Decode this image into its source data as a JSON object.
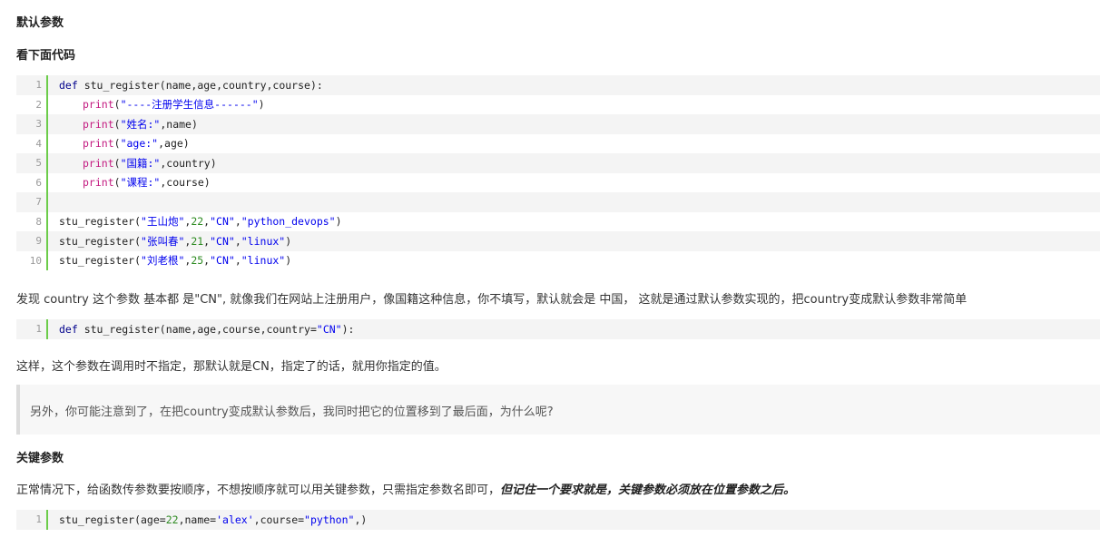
{
  "headings": {
    "default_params": "默认参数",
    "see_code": "看下面代码",
    "keyword_params": "关键参数"
  },
  "code_block_1": {
    "line_numbers": [
      "1",
      "2",
      "3",
      "4",
      "5",
      "6",
      "7",
      "8",
      "9",
      "10"
    ],
    "lines": {
      "l1": {
        "kw": "def",
        "rest": " stu_register(name,age,country,course):"
      },
      "l2": {
        "fn": "print",
        "a": "(",
        "s": "\"----注册学生信息------\"",
        "b": ")"
      },
      "l3": {
        "fn": "print",
        "a": "(",
        "s": "\"姓名:\"",
        "b": ",name)"
      },
      "l4": {
        "fn": "print",
        "a": "(",
        "s": "\"age:\"",
        "b": ",age)"
      },
      "l5": {
        "fn": "print",
        "a": "(",
        "s": "\"国籍:\"",
        "b": ",country)"
      },
      "l6": {
        "fn": "print",
        "a": "(",
        "s": "\"课程:\"",
        "b": ",course)"
      },
      "l8": {
        "a": "stu_register(",
        "s1": "\"王山炮\"",
        "c1": ",",
        "n": "22",
        "c2": ",",
        "s2": "\"CN\"",
        "c3": ",",
        "s3": "\"python_devops\"",
        "b": ")"
      },
      "l9": {
        "a": "stu_register(",
        "s1": "\"张叫春\"",
        "c1": ",",
        "n": "21",
        "c2": ",",
        "s2": "\"CN\"",
        "c3": ",",
        "s3": "\"linux\"",
        "b": ")"
      },
      "l10": {
        "a": "stu_register(",
        "s1": "\"刘老根\"",
        "c1": ",",
        "n": "25",
        "c2": ",",
        "s2": "\"CN\"",
        "c3": ",",
        "s3": "\"linux\"",
        "b": ")"
      }
    }
  },
  "para_1": "发现 country 这个参数 基本都 是\"CN\", 就像我们在网站上注册用户，像国籍这种信息，你不填写，默认就会是 中国，  这就是通过默认参数实现的，把country变成默认参数非常简单",
  "code_block_2": {
    "line_number": "1",
    "kw": "def",
    "a": " stu_register(name,age,course,country=",
    "s": "\"CN\"",
    "b": "):"
  },
  "para_2": "这样，这个参数在调用时不指定，那默认就是CN，指定了的话，就用你指定的值。",
  "quote": "另外，你可能注意到了，在把country变成默认参数后，我同时把它的位置移到了最后面，为什么呢?",
  "para_3": {
    "normal": "正常情况下，给函数传参数要按顺序，不想按顺序就可以用关键参数，只需指定参数名即可，",
    "emphasis": "但记住一个要求就是，关键参数必须放在位置参数之后。"
  },
  "code_block_3": {
    "line_number": "1",
    "a": "stu_register(age=",
    "n": "22",
    "b": ",name=",
    "s1": "'alex'",
    "c": ",course=",
    "s2": "\"python\"",
    "d": ",)"
  },
  "colors": {
    "gutter_bar": "#6ccc4a",
    "keyword": "#00008b",
    "builtin": "#c31a80",
    "string": "#0000ee",
    "number": "#2e8b22"
  }
}
